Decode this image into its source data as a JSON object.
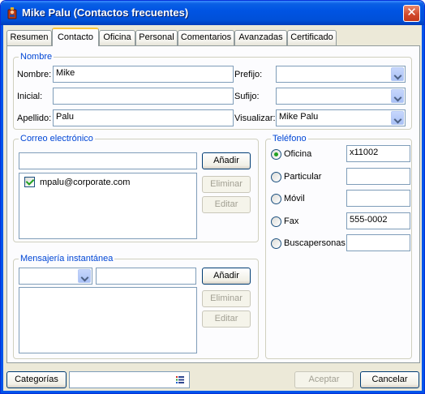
{
  "window": {
    "title": "Mike Palu (Contactos frecuentes)"
  },
  "tabs": [
    {
      "label": "Resumen"
    },
    {
      "label": "Contacto"
    },
    {
      "label": "Oficina"
    },
    {
      "label": "Personal"
    },
    {
      "label": "Comentarios"
    },
    {
      "label": "Avanzadas"
    },
    {
      "label": "Certificado"
    }
  ],
  "active_tab": "Contacto",
  "nombre": {
    "group_label": "Nombre",
    "nombre_label": "Nombre:",
    "nombre_value": "Mike",
    "inicial_label": "Inicial:",
    "inicial_value": "",
    "apellido_label": "Apellido:",
    "apellido_value": "Palu",
    "prefijo_label": "Prefijo:",
    "prefijo_value": "",
    "sufijo_label": "Sufijo:",
    "sufijo_value": "",
    "visualizar_label": "Visualizar:",
    "visualizar_value": "Mike Palu"
  },
  "correo": {
    "group_label": "Correo electrónico",
    "input_value": "",
    "add_label": "Añadir",
    "remove_label": "Eliminar",
    "edit_label": "Editar",
    "emails": [
      {
        "address": "mpalu@corporate.com",
        "checked": true
      }
    ]
  },
  "mensajeria": {
    "group_label": "Mensajería instantánea",
    "service_value": "",
    "address_value": "",
    "add_label": "Añadir",
    "remove_label": "Eliminar",
    "edit_label": "Editar"
  },
  "telefono": {
    "group_label": "Teléfono",
    "options": [
      {
        "label": "Oficina",
        "value": "x11002",
        "selected": true
      },
      {
        "label": "Particular",
        "value": "",
        "selected": false
      },
      {
        "label": "Móvil",
        "value": "",
        "selected": false
      },
      {
        "label": "Fax",
        "value": "555-0002",
        "selected": false
      },
      {
        "label": "Buscapersonas",
        "value": "",
        "selected": false
      }
    ]
  },
  "footer": {
    "categories_label": "Categorías",
    "categories_value": "",
    "accept_label": "Aceptar",
    "cancel_label": "Cancelar"
  },
  "colors": {
    "title_bar": "#0054E3",
    "group_label": "#0046D5",
    "active_tab_accent": "#FFC83C"
  }
}
